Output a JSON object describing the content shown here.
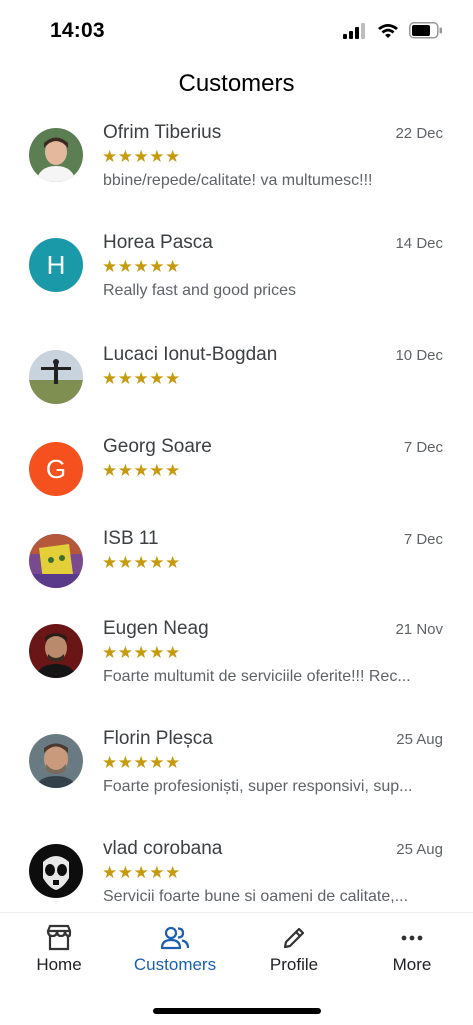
{
  "status_bar": {
    "time": "14:03"
  },
  "page_title": "Customers",
  "reviews": [
    {
      "name": "Ofrim Tiberius",
      "date": "22 Dec",
      "stars": "★★★★★",
      "rating": 5,
      "text": "bbine/repede/calitate! va multumesc!!!",
      "avatar_type": "photo"
    },
    {
      "name": "Horea Pasca",
      "date": "14 Dec",
      "stars": "★★★★★",
      "rating": 5,
      "text": "Really fast and good prices",
      "avatar_type": "letter",
      "avatar_letter": "H",
      "avatar_color": "#1a9aa8"
    },
    {
      "name": "Lucaci Ionut-Bogdan",
      "date": "10 Dec",
      "stars": "★★★★★",
      "rating": 5,
      "text": "",
      "avatar_type": "photo"
    },
    {
      "name": "Georg Soare",
      "date": "7 Dec",
      "stars": "★★★★★",
      "rating": 5,
      "text": "",
      "avatar_type": "letter",
      "avatar_letter": "G",
      "avatar_color": "#f4511e"
    },
    {
      "name": "ISB 11",
      "date": "7 Dec",
      "stars": "★★★★★",
      "rating": 5,
      "text": "",
      "avatar_type": "photo"
    },
    {
      "name": "Eugen Neag",
      "date": "21 Nov",
      "stars": "★★★★★",
      "rating": 5,
      "text": "Foarte multumit de serviciile oferite!!! Rec...",
      "avatar_type": "photo"
    },
    {
      "name": "Florin Pleșca",
      "date": "25 Aug",
      "stars": "★★★★★",
      "rating": 5,
      "text": "Foarte profesioniști, super responsivi, sup...",
      "avatar_type": "photo"
    },
    {
      "name": "vlad corobana",
      "date": "25 Aug",
      "stars": "★★★★★",
      "rating": 5,
      "text": "Servicii foarte bune si oameni de calitate,...",
      "avatar_type": "photo"
    }
  ],
  "nav": {
    "home": "Home",
    "customers": "Customers",
    "profile": "Profile",
    "more": "More",
    "active": "customers"
  },
  "colors": {
    "star": "#c79a0e",
    "active_nav": "#1a5fb4"
  }
}
